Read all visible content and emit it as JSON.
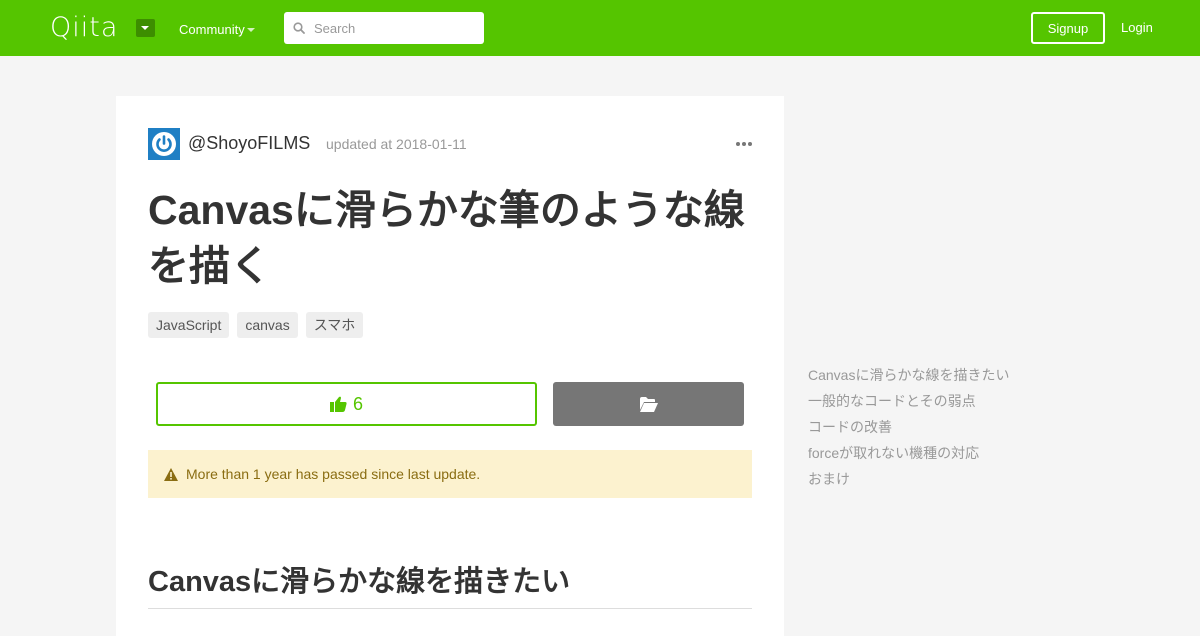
{
  "header": {
    "logo": "Qiita",
    "community_label": "Community",
    "search_placeholder": "Search",
    "signup_label": "Signup",
    "login_label": "Login",
    "brand_color": "#55c500"
  },
  "article": {
    "author": "@ShoyoFILMS",
    "updated": "updated at 2018-01-11",
    "title": "Canvasに滑らかな筆のような線を描く",
    "tags": [
      "JavaScript",
      "canvas",
      "スマホ"
    ],
    "like_count": "6",
    "alert_text": "More than 1 year has passed since last update.",
    "section_heading": "Canvasに滑らかな線を描きたい",
    "icons": {
      "more": "more-icon",
      "like": "thumbs-up-icon",
      "stock": "folder-open-icon",
      "alert": "warning-icon",
      "avatar": "power-icon"
    }
  },
  "toc": {
    "items": [
      "Canvasに滑らかな線を描きたい",
      "一般的なコードとその弱点",
      "コードの改善",
      "forceが取れない機種の対応",
      "おまけ"
    ]
  }
}
